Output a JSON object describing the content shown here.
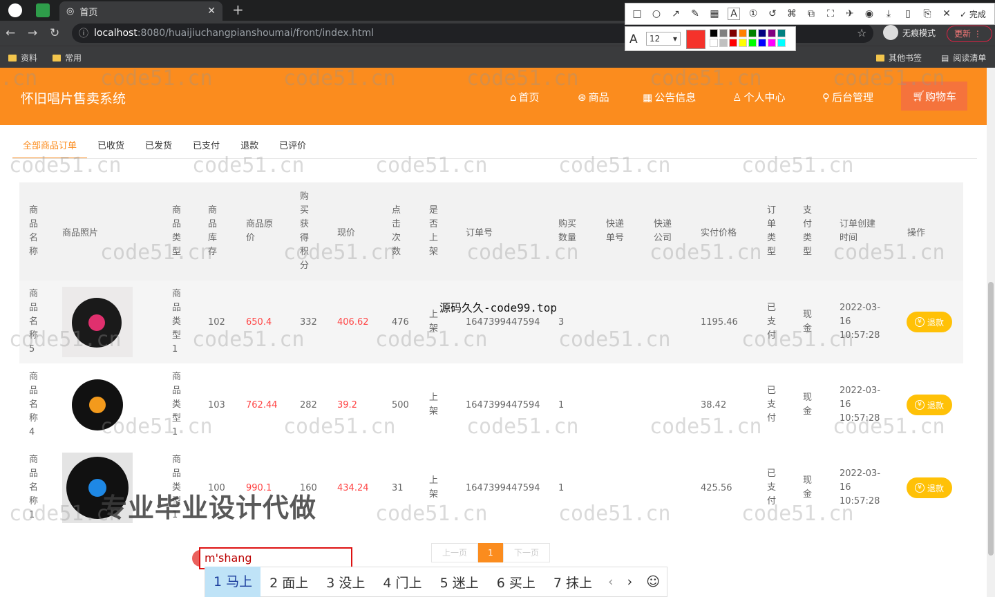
{
  "browser": {
    "tab_title": "首页",
    "url_host": "localhost",
    "url_path": ":8080/huaijiuchangpianshoumai/front/index.html",
    "incognito_label": "无痕模式",
    "update_label": "更新",
    "bookmarks": [
      "资料",
      "常用"
    ],
    "bookmarks_right": [
      "其他书签",
      "阅读清单"
    ]
  },
  "snip_tool": {
    "font_size": "12",
    "done_label": "完成",
    "current_color": "#f5322b",
    "palette": [
      "#000000",
      "#808080",
      "#800000",
      "#ff8000",
      "#008000",
      "#000080",
      "#800080",
      "#008080",
      "#ffffff",
      "#c0c0c0",
      "#ff0000",
      "#ffff00",
      "#00ff00",
      "#0000ff",
      "#ff00ff",
      "#00ffff"
    ]
  },
  "header": {
    "brand": "怀旧唱片售卖系统",
    "nav": [
      {
        "icon": "home-icon",
        "label": "首页"
      },
      {
        "icon": "goods-icon",
        "label": "商品"
      },
      {
        "icon": "notice-icon",
        "label": "公告信息"
      },
      {
        "icon": "user-icon",
        "label": "个人中心"
      },
      {
        "icon": "link-icon",
        "label": "后台管理"
      }
    ],
    "cart_label": "购物车",
    "accent": "#fb8c1e"
  },
  "order_tabs": [
    "全部商品订单",
    "已收货",
    "已发货",
    "已支付",
    "退款",
    "已评价"
  ],
  "table": {
    "headers": {
      "name": "商品名称",
      "photo": "商品照片",
      "type": "商品类型",
      "stock": "商品库存",
      "orig_price": "商品原价",
      "points": "购买获得积分",
      "price": "现价",
      "clicks": "点击次数",
      "onsale": "是否上架",
      "order_no": "订单号",
      "qty": "购买数量",
      "express_no": "快递单号",
      "express_co": "快递公司",
      "paid": "实付价格",
      "order_type": "订单类型",
      "pay_type": "支付类型",
      "created": "订单创建时间",
      "action": "操作"
    },
    "rows": [
      {
        "name": "商品名称5",
        "type": "商品类型1",
        "stock": "102",
        "orig_price": "650.4",
        "points": "332",
        "price": "406.62",
        "clicks": "476",
        "onsale": "上架",
        "order_no": "1647399447594",
        "qty": "3",
        "express_no": "",
        "express_co": "",
        "paid": "1195.46",
        "order_type": "已支付",
        "pay_type": "现金",
        "created": "2022-03-16 10:57:28",
        "action": "退款",
        "record_label": "#e0306e"
      },
      {
        "name": "商品名称4",
        "type": "商品类型1",
        "stock": "103",
        "orig_price": "762.44",
        "points": "282",
        "price": "39.2",
        "clicks": "500",
        "onsale": "上架",
        "order_no": "1647399447594",
        "qty": "1",
        "express_no": "",
        "express_co": "",
        "paid": "38.42",
        "order_type": "已支付",
        "pay_type": "现金",
        "created": "2022-03-16 10:57:28",
        "action": "退款",
        "record_label": "#f39a1c"
      },
      {
        "name": "商品名称1",
        "type": "商品类型1",
        "stock": "100",
        "orig_price": "990.1",
        "points": "160",
        "price": "434.24",
        "clicks": "31",
        "onsale": "上架",
        "order_no": "1647399447594",
        "qty": "1",
        "express_no": "",
        "express_co": "",
        "paid": "425.56",
        "order_type": "已支付",
        "pay_type": "现金",
        "created": "2022-03-16 10:57:28",
        "action": "退款",
        "record_label": "#1e88e5"
      }
    ]
  },
  "pager": {
    "prev": "上一页",
    "current": "1",
    "next": "下一页"
  },
  "overlay": {
    "watermark": "code51.cn",
    "source_text": "源码久久-code99.top",
    "pro_text": "专业毕业设计代做",
    "ime_input": "m'shang",
    "ime_candidates": [
      "1 马上",
      "2 面上",
      "3 没上",
      "4 门上",
      "5 迷上",
      "6 买上",
      "7 抹上"
    ]
  }
}
